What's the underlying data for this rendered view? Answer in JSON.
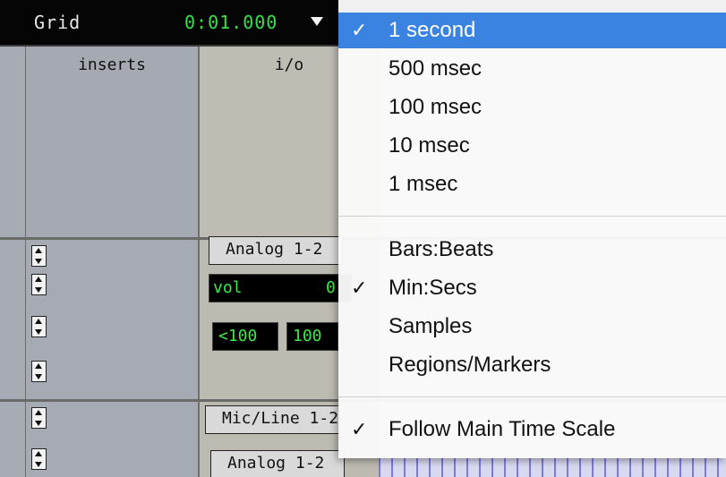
{
  "grid_bar": {
    "label": "Grid",
    "value": "0:01.000",
    "dropdown_icon": "triangle-down-icon"
  },
  "columns": {
    "inserts": "inserts",
    "io": "i/o"
  },
  "tracks": [
    {
      "io_output": "Analog 1-2",
      "vol_label": "vol",
      "vol_value": "0",
      "pan_left": "<100",
      "pan_right": "100"
    },
    {
      "io_input": "Mic/Line 1-2",
      "io_output": "Analog 1-2"
    }
  ],
  "menu": {
    "check_mark": "✓",
    "resolution_items": [
      {
        "label": "1 second",
        "checked": true,
        "highlighted": true
      },
      {
        "label": "500 msec",
        "checked": false
      },
      {
        "label": "100 msec",
        "checked": false
      },
      {
        "label": "10 msec",
        "checked": false
      },
      {
        "label": "1 msec",
        "checked": false
      }
    ],
    "scale_items": [
      {
        "label": "Bars:Beats",
        "checked": false
      },
      {
        "label": "Min:Secs",
        "checked": true
      },
      {
        "label": "Samples",
        "checked": false
      },
      {
        "label": "Regions/Markers",
        "checked": false
      }
    ],
    "follow_item": {
      "label": "Follow Main Time Scale",
      "checked": true
    }
  },
  "colors": {
    "highlight": "#3b83e0",
    "lcd_green": "#3ee84a"
  }
}
